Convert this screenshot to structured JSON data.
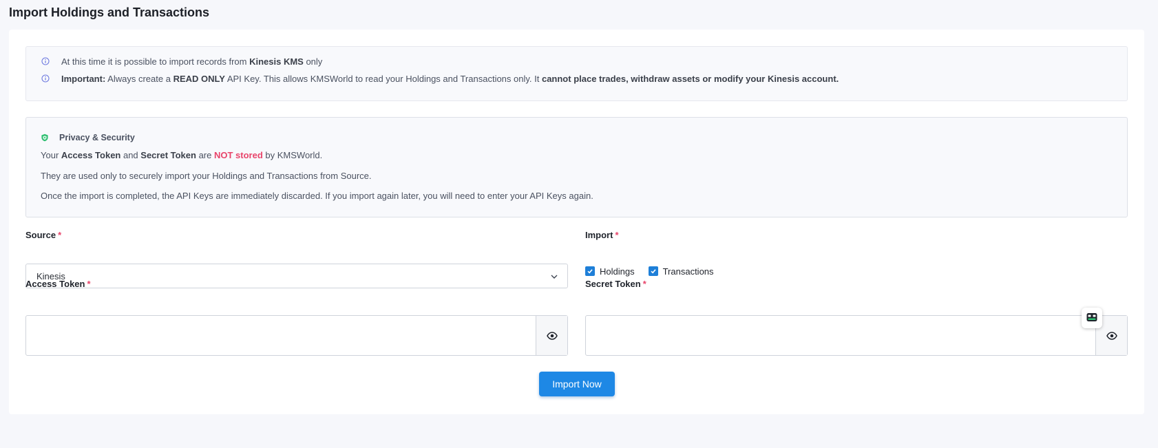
{
  "page": {
    "title": "Import Holdings and Transactions"
  },
  "info": {
    "line1_prefix": "At this time it is possible to import records from ",
    "line1_bold": "Kinesis KMS",
    "line1_suffix": " only",
    "line2_label": "Important:",
    "line2_text1": " Always create a ",
    "line2_bold1": "READ ONLY",
    "line2_text2": " API Key. This allows KMSWorld to read your Holdings and Transactions only. It ",
    "line2_bold2": "cannot place trades, withdraw assets or modify your Kinesis account."
  },
  "privacy": {
    "title": "Privacy & Security",
    "p1_text1": "Your ",
    "p1_bold1": "Access Token",
    "p1_text2": " and ",
    "p1_bold2": "Secret Token",
    "p1_text3": " are ",
    "p1_danger": "NOT stored",
    "p1_text4": " by KMSWorld.",
    "p2": "They are used only to securely import your Holdings and Transactions from Source.",
    "p3": "Once the import is completed, the API Keys are immediately discarded. If you import again later, you will need to enter your API Keys again."
  },
  "form": {
    "required_mark": "*",
    "source_label": "Source",
    "source_value": "Kinesis",
    "import_label": "Import",
    "options": [
      {
        "label": "Holdings",
        "checked": true
      },
      {
        "label": "Transactions",
        "checked": true
      }
    ],
    "access_token_label": "Access Token",
    "access_token_value": "",
    "secret_token_label": "Secret Token",
    "secret_token_value": "",
    "submit_label": "Import Now"
  },
  "colors": {
    "accent": "#1e88e5",
    "checkbox": "#1e7fd8",
    "danger": "#e8446a",
    "info_icon": "#6f7be0",
    "shield_icon": "#2fbf71"
  },
  "icons": {
    "info": "info-circle-icon",
    "privacy": "shield-icon",
    "select": "chevron-down-icon",
    "reveal": "eye-icon",
    "chat": "chat-bot-icon"
  }
}
